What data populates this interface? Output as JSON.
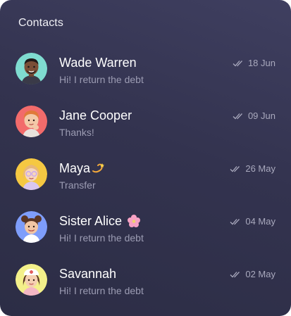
{
  "header": {
    "title": "Contacts"
  },
  "contacts": [
    {
      "name": "Wade Warren",
      "message": "Hi! I return the debt",
      "date": "18 Jun",
      "avatar_bg": "#7fdcd0"
    },
    {
      "name": "Jane Cooper",
      "message": "Thanks!",
      "date": "09 Jun",
      "avatar_bg": "#f26b6b"
    },
    {
      "name": "Maya",
      "message": "Transfer",
      "date": "26 May",
      "avatar_bg": "#f5c842",
      "emoji": "dizzy-emoji"
    },
    {
      "name": "Sister Alice",
      "message": "Hi! I return the debt",
      "date": "04 May",
      "avatar_bg": "#7e9dfb",
      "emoji": "cherry-blossom-emoji"
    },
    {
      "name": "Savannah",
      "message": "Hi! I return the debt",
      "date": "02 May",
      "avatar_bg": "#f3f08a"
    }
  ],
  "colors": {
    "card_bg": "#35354f",
    "muted_text": "#9c9cb3",
    "primary_text": "#ffffff"
  }
}
